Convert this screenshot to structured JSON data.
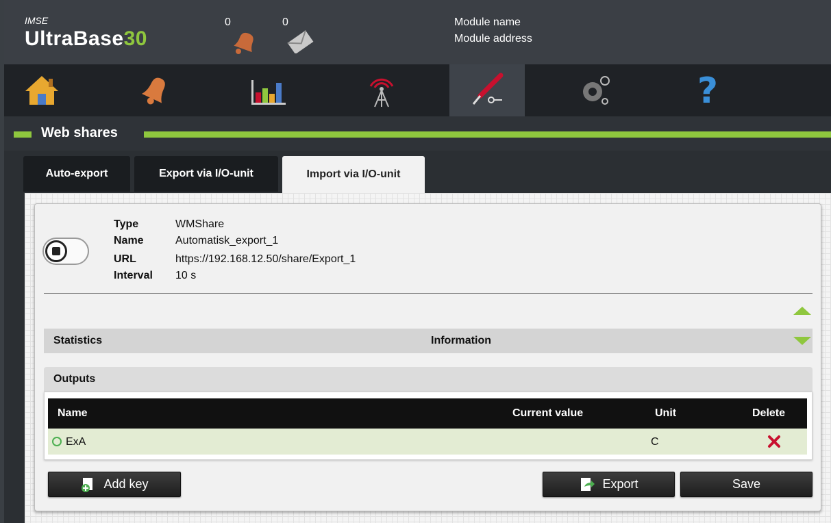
{
  "header": {
    "brand_small": "IMSE",
    "brand_main": "UltraBase",
    "brand_num": "30",
    "alarm_count": "0",
    "message_count": "0",
    "module_name": "Module name",
    "module_address": "Module address"
  },
  "nav": {
    "items": [
      {
        "icon": "home-icon"
      },
      {
        "icon": "bell-icon"
      },
      {
        "icon": "chart-icon"
      },
      {
        "icon": "antenna-icon"
      },
      {
        "icon": "tools-icon",
        "active": true
      },
      {
        "icon": "gears-icon"
      },
      {
        "icon": "help-icon"
      }
    ]
  },
  "section": {
    "title": "Web shares"
  },
  "tabs": [
    {
      "label": "Auto-export"
    },
    {
      "label": "Export via I/O-unit"
    },
    {
      "label": "Import via I/O-unit",
      "active": true
    }
  ],
  "share": {
    "type_label": "Type",
    "type_value": "WMShare",
    "name_label": "Name",
    "name_value": "Automatisk_export_1",
    "url_label": "URL",
    "url_value": "https://192.168.12.50/share/Export_1",
    "interval_label": "Interval",
    "interval_value": "10 s",
    "enabled": false
  },
  "stats": {
    "statistics_label": "Statistics",
    "information_label": "Information"
  },
  "outputs": {
    "title": "Outputs",
    "columns": [
      "Name",
      "Current value",
      "Unit",
      "Delete"
    ],
    "rows": [
      {
        "name": "ExA",
        "current_value": "",
        "unit": "C"
      }
    ]
  },
  "buttons": {
    "add_key": "Add key",
    "export": "Export",
    "save": "Save"
  },
  "colors": {
    "accent": "#8fc73e",
    "header_bg": "#3b3f45",
    "nav_bg": "#1f2226",
    "delete": "#c8102e"
  }
}
